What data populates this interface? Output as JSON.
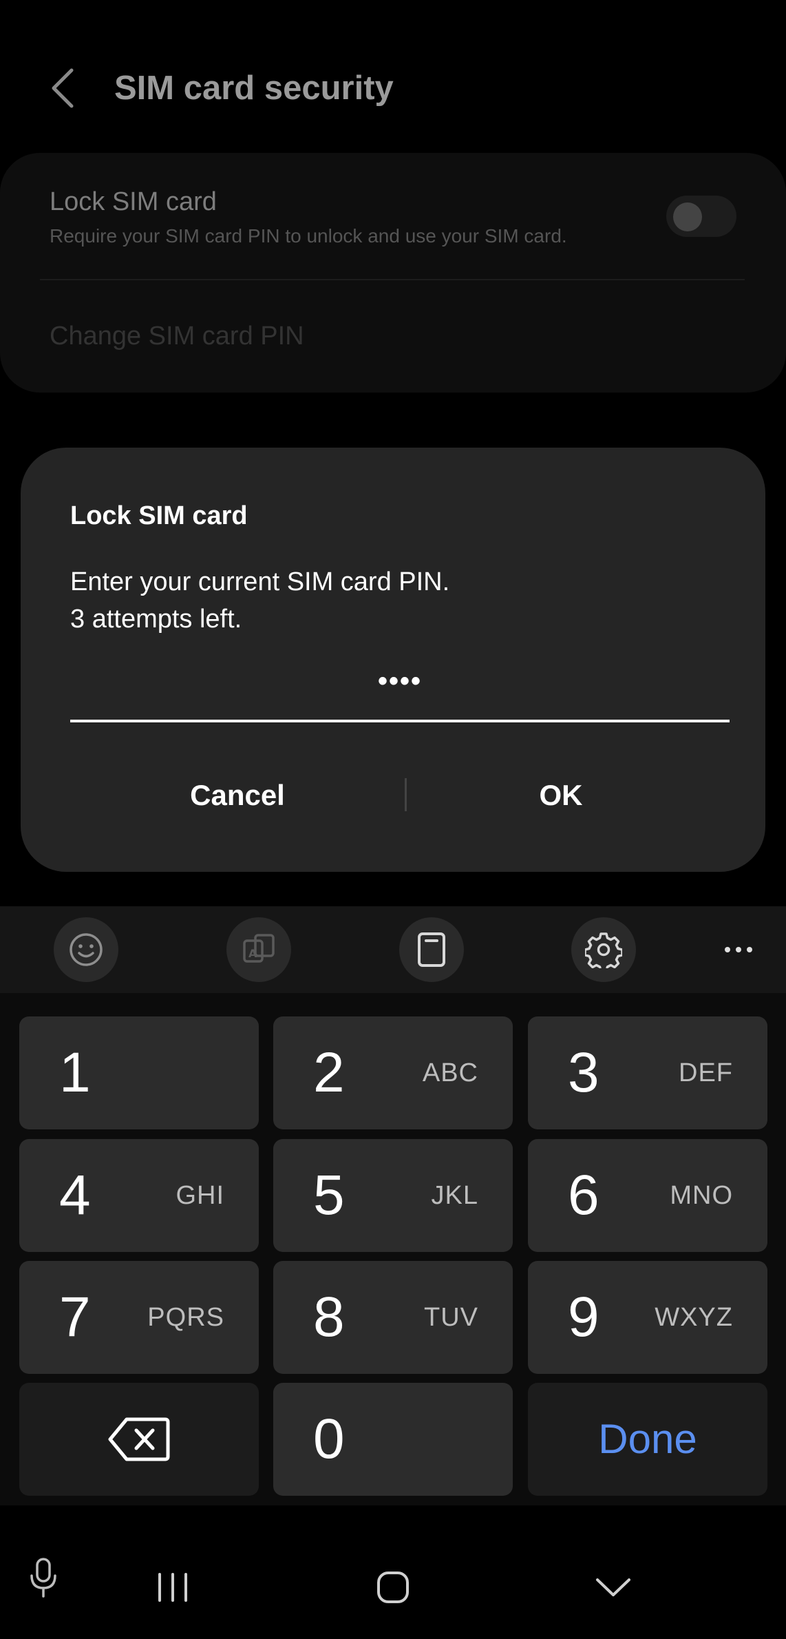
{
  "header": {
    "title": "SIM card security",
    "back_icon": "chevron-left-icon"
  },
  "settings": {
    "lock_sim": {
      "title": "Lock SIM card",
      "subtitle": "Require your SIM card PIN to unlock and use your SIM card.",
      "toggle_on": false
    },
    "change_pin_label": "Change SIM card PIN"
  },
  "dialog": {
    "title": "Lock SIM card",
    "message": "Enter your current SIM card PIN.\n3 attempts left.",
    "pin_value": "••••",
    "cancel_label": "Cancel",
    "ok_label": "OK"
  },
  "keyboard_toolbar": {
    "icons": [
      "emoji-icon",
      "translate-icon",
      "clipboard-icon",
      "settings-gear-icon",
      "more-icon"
    ]
  },
  "keypad": {
    "keys": [
      {
        "num": "1",
        "letters": ""
      },
      {
        "num": "2",
        "letters": "ABC"
      },
      {
        "num": "3",
        "letters": "DEF"
      },
      {
        "num": "4",
        "letters": "GHI"
      },
      {
        "num": "5",
        "letters": "JKL"
      },
      {
        "num": "6",
        "letters": "MNO"
      },
      {
        "num": "7",
        "letters": "PQRS"
      },
      {
        "num": "8",
        "letters": "TUV"
      },
      {
        "num": "9",
        "letters": "WXYZ"
      },
      {
        "num": "0",
        "letters": ""
      }
    ],
    "backspace_icon": "backspace-icon",
    "done_label": "Done",
    "done_color": "#5b8ff0"
  },
  "navbar": {
    "icons": [
      "microphone-icon",
      "recent-apps-icon",
      "home-icon",
      "hide-keyboard-icon"
    ]
  }
}
